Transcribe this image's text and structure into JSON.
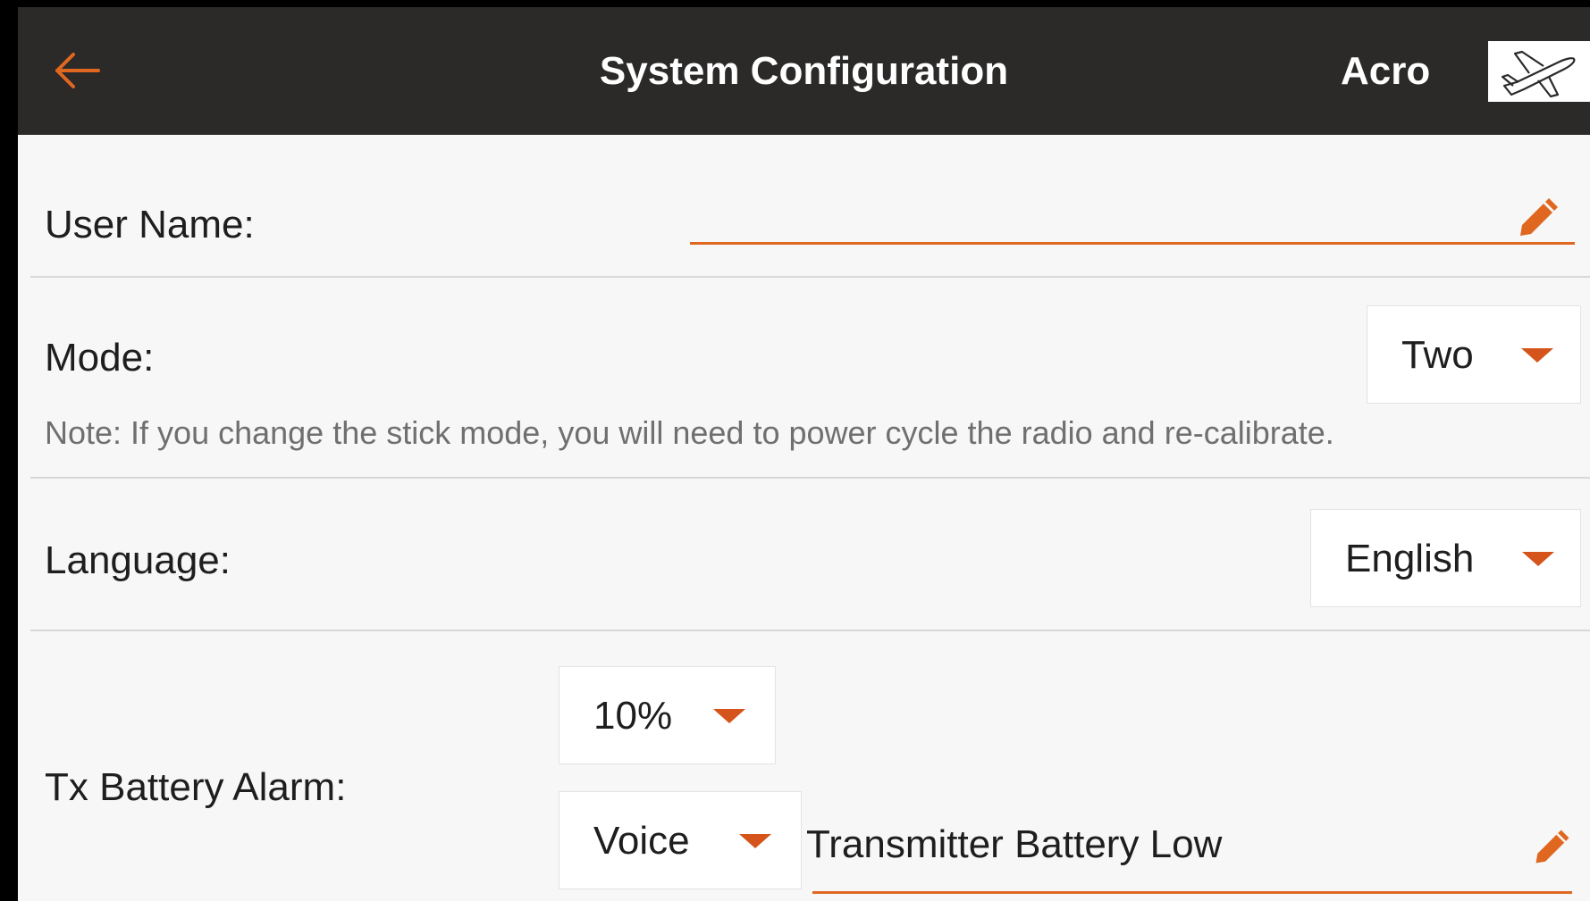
{
  "header": {
    "title": "System Configuration",
    "model_type": "Acro",
    "back_icon": "back-arrow-icon",
    "model_icon": "airplane-icon"
  },
  "user_name": {
    "label": "User Name:",
    "value": "",
    "icon": "pencil-icon"
  },
  "mode": {
    "label": "Mode:",
    "selected": "Two",
    "note": "Note: If you change the stick mode, you will need to power cycle the radio and re-calibrate."
  },
  "language": {
    "label": "Language:",
    "selected": "English"
  },
  "tx_battery_alarm": {
    "label": "Tx Battery Alarm:",
    "threshold": "10%",
    "alert_type": "Voice",
    "alert_text": "Transmitter Battery Low",
    "icon": "pencil-icon"
  },
  "colors": {
    "accent": "#e0671f",
    "header_bg": "#2b2a29",
    "caret": "#d4541b"
  }
}
